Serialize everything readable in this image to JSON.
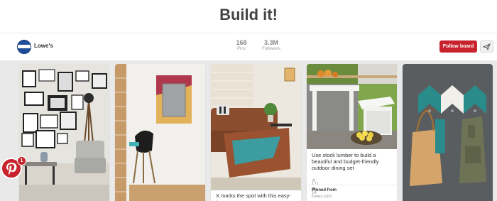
{
  "board": {
    "title": "Build it!"
  },
  "owner": {
    "name": "Lowe's",
    "logo_icon": "lowes-logo"
  },
  "stats": {
    "pins_count": "168",
    "pins_label": "Pins",
    "followers_count": "3.3M",
    "followers_label": "Followers"
  },
  "actions": {
    "follow_label": "Follow board",
    "send_icon": "send-icon"
  },
  "colors": {
    "brand_red": "#c8232c",
    "lowes_blue": "#1f4f9c"
  },
  "pins": [
    {
      "image": "gallery-wall-living-room"
    },
    {
      "image": "chevron-mirror-hallway"
    },
    {
      "image": "wooden-coffee-table-living-room",
      "description": "X marks the spot with this easy-to-"
    },
    {
      "image": "outdoor-dining-set",
      "description": "Use stock lumber to build a beautiful and budget-friendly outdoor dining set",
      "repins": "171",
      "likes": "14",
      "pinned_from_label": "Pinned from",
      "pinned_from_source": "lowes.com"
    },
    {
      "image": "chevron-wall-hooks-bags"
    }
  ],
  "notifications": {
    "count": "1",
    "badge_icon": "pinterest-icon"
  }
}
